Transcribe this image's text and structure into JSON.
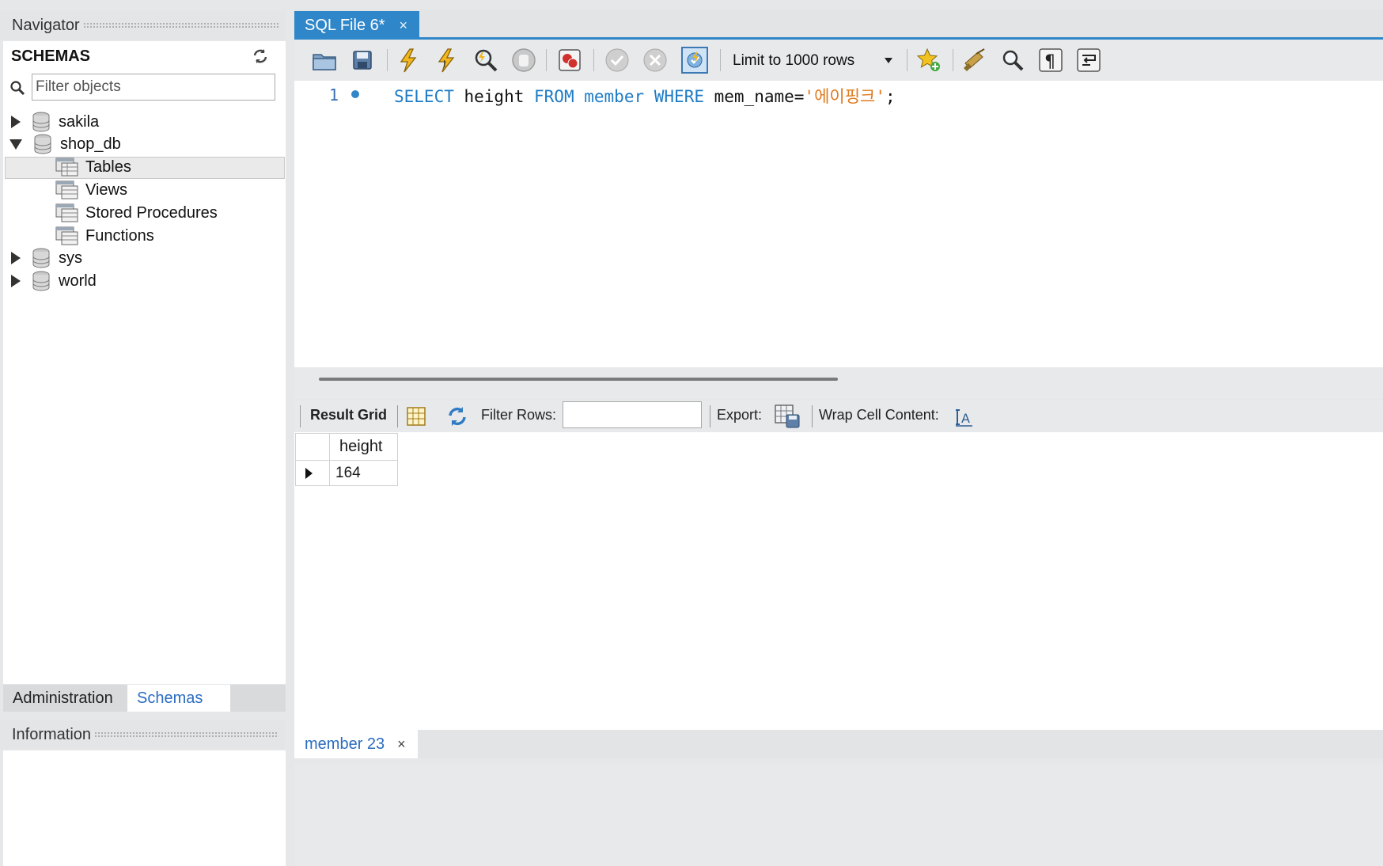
{
  "navigator": {
    "title": "Navigator",
    "schemas_header": "SCHEMAS",
    "filter_placeholder": "Filter objects",
    "tree": {
      "databases": [
        "sakila",
        "shop_db",
        "sys",
        "world"
      ],
      "shop_db_children": [
        "Tables",
        "Views",
        "Stored Procedures",
        "Functions"
      ]
    },
    "tabs": {
      "administration": "Administration",
      "schemas": "Schemas"
    },
    "information_title": "Information"
  },
  "editor": {
    "tab_label": "SQL File 6*",
    "tab_close": "×",
    "limit_label": "Limit to 1000 rows",
    "line_number": "1",
    "code": {
      "kw_select": "SELECT",
      "col": " height ",
      "kw_from": "FROM",
      "sp1": " ",
      "table": "member",
      "sp2": " ",
      "kw_where": "WHERE",
      "cond": " mem_name=",
      "value": "'에이핑크'",
      "end": ";"
    }
  },
  "result": {
    "result_grid_label": "Result Grid",
    "filter_rows_label": "Filter Rows:",
    "export_label": "Export:",
    "wrap_label": "Wrap Cell Content:",
    "columns": [
      "height"
    ],
    "rows": [
      [
        "164"
      ]
    ]
  },
  "bottom_tab": {
    "label": "member 23",
    "close": "×"
  },
  "colors": {
    "accent": "#2f86c9",
    "keyword": "#1d7bc5",
    "string": "#e07a1f"
  }
}
